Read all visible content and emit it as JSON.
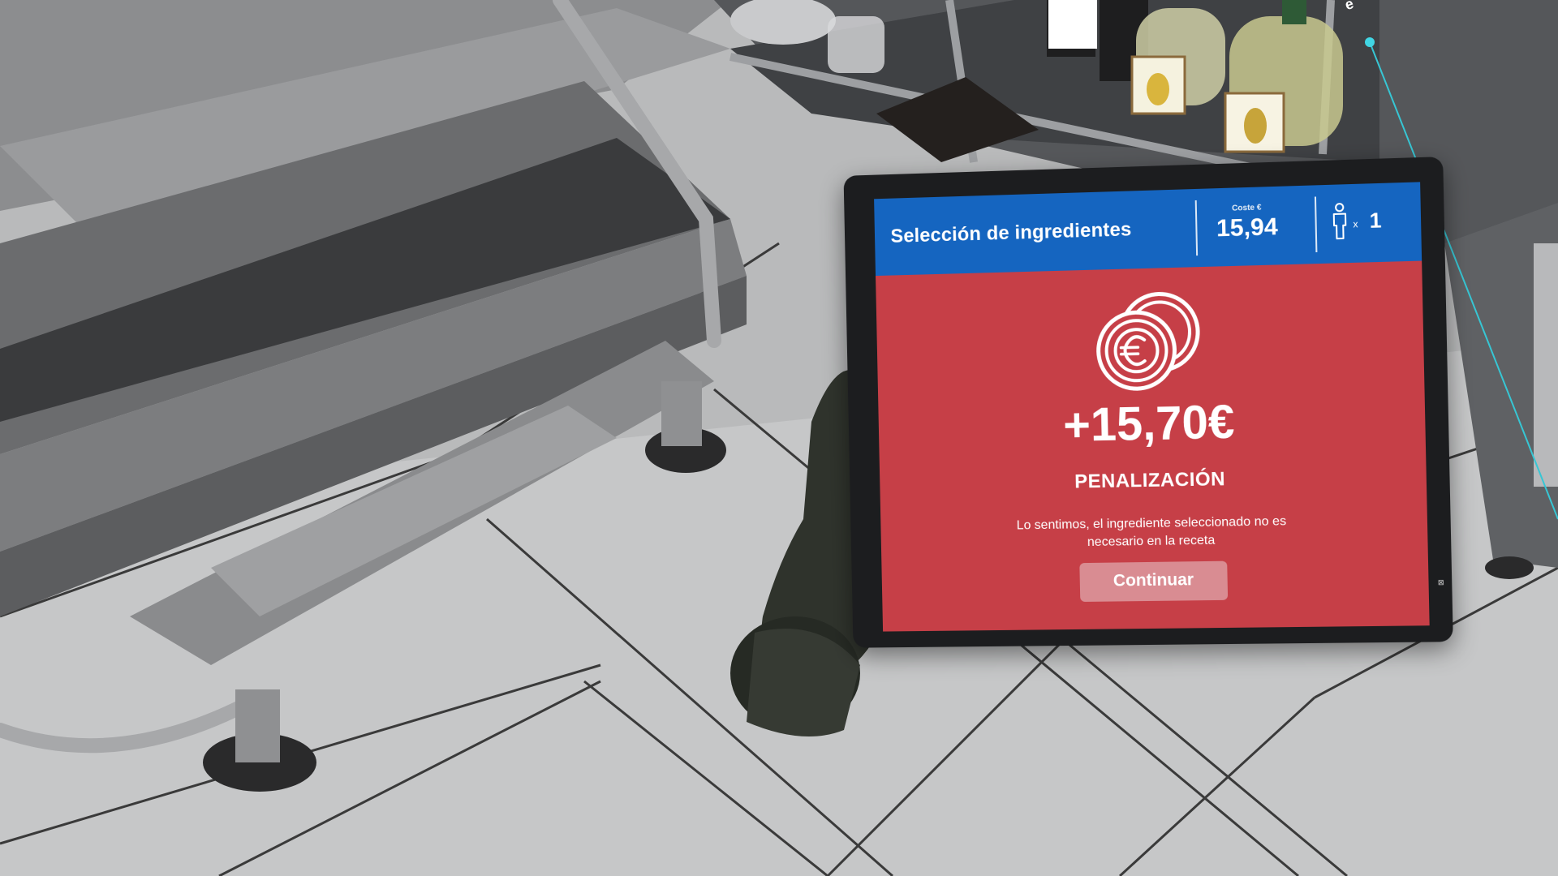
{
  "tablet": {
    "header": {
      "title": "Selección de ingredientes",
      "cost_label": "Coste €",
      "cost_value": "15,94",
      "people_multiplier": "x",
      "people_count": "1"
    },
    "penalty": {
      "amount": "+15,70€",
      "title": "PENALIZACIÓN",
      "message": "Lo sentimos, el ingrediente seleccionado no es necesario en la receta",
      "continue_label": "Continuar"
    }
  },
  "colors": {
    "header_blue": "#1565c0",
    "penalty_red": "#c63f47",
    "button_pink": "#d98c92"
  },
  "icons": [
    "coins-euro-icon",
    "person-icon"
  ]
}
